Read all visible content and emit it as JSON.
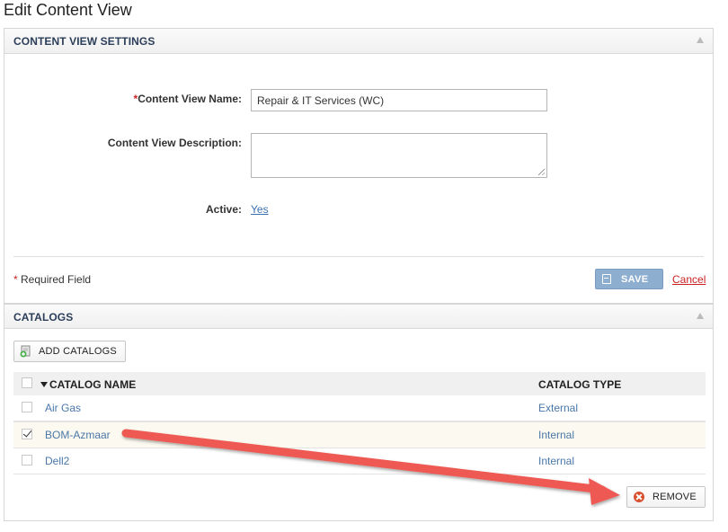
{
  "page": {
    "title": "Edit Content View"
  },
  "settings_panel": {
    "title": "CONTENT VIEW SETTINGS",
    "required_star": "*",
    "name_label": "Content View Name:",
    "name_value": "Repair & IT Services (WC)",
    "description_label": "Content View Description:",
    "description_value": "",
    "active_label": "Active:",
    "active_value": "Yes",
    "required_note_star": "*",
    "required_note": " Required Field",
    "save_label": "SAVE",
    "cancel_label": "Cancel"
  },
  "catalogs_panel": {
    "title": "CATALOGS",
    "add_button_label": "ADD CATALOGS",
    "columns": {
      "name": "CATALOG NAME",
      "type": "CATALOG TYPE"
    },
    "rows": [
      {
        "name": "Air Gas",
        "type": "External",
        "checked": false
      },
      {
        "name": "BOM-Azmaar",
        "type": "Internal",
        "checked": true
      },
      {
        "name": "Dell2",
        "type": "Internal",
        "checked": false
      }
    ],
    "remove_button_label": "REMOVE"
  },
  "colors": {
    "header_text": "#2c3e5a",
    "link": "#4a77a8",
    "save_button": "#8eaed0",
    "cancel": "#cc2222",
    "annotation_arrow": "#ee5a52",
    "remove_icon": "#d9502f"
  }
}
